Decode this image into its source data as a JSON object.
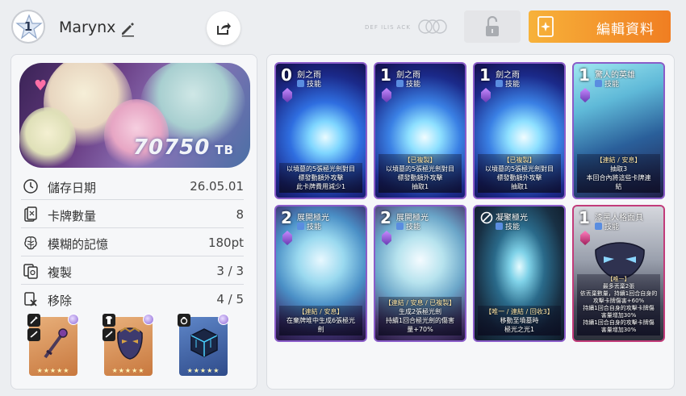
{
  "header": {
    "level": "1",
    "player_name": "Marynx",
    "watermark": "DEF ILIS ACK",
    "edit_profile_label": "編輯資料"
  },
  "profile": {
    "tb_value": "70750",
    "tb_unit": "TB",
    "stats": [
      {
        "icon": "clock-icon",
        "label": "儲存日期",
        "value": "26.05.01"
      },
      {
        "icon": "cards-icon",
        "label": "卡牌數量",
        "value": "8"
      },
      {
        "icon": "brain-icon",
        "label": "模糊的記憶",
        "value": "180pt"
      },
      {
        "icon": "copy-icon",
        "label": "複製",
        "value": "3 / 3"
      },
      {
        "icon": "remove-icon",
        "label": "移除",
        "value": "4 / 5"
      }
    ],
    "items": [
      {
        "name": "weapon-item",
        "stars": "★★★★★"
      },
      {
        "name": "armor-item",
        "stars": "★★★★★"
      },
      {
        "name": "accessory-item",
        "stars": "★★★★★"
      }
    ]
  },
  "cards": [
    {
      "cost": "0",
      "name": "劍之雨",
      "type": "技能",
      "desc": [
        "以墳墓的5張極光劍對目",
        "標發動額外攻擊",
        "此卡牌費用減少1"
      ],
      "tag": ""
    },
    {
      "cost": "1",
      "name": "劍之雨",
      "type": "技能",
      "desc": [
        "以墳墓的5張極光劍對目",
        "標發動額外攻擊",
        "抽取1"
      ],
      "tag": "【已複製】"
    },
    {
      "cost": "1",
      "name": "劍之雨",
      "type": "技能",
      "desc": [
        "以墳墓的5張極光劍對目",
        "標發動額外攻擊",
        "抽取1"
      ],
      "tag": "【已複製】"
    },
    {
      "cost": "1",
      "name": "驚人的英雄",
      "type": "技能",
      "desc": [
        "抽取3",
        "本回合內將這些卡牌連",
        "結"
      ],
      "tag": "【連結 / 安息】"
    },
    {
      "cost": "2",
      "name": "展開極光",
      "type": "技能",
      "desc": [
        "在棄牌堆中生成6張極光",
        "劍"
      ],
      "tag": "【連結 / 安息】"
    },
    {
      "cost": "2",
      "name": "展開極光",
      "type": "技能",
      "desc": [
        "生成2張極光劍",
        "持續1回合極光劍的傷害",
        "量+70%"
      ],
      "tag": "【連結 / 安息 / 已複製】"
    },
    {
      "cost": "",
      "name": "凝聚極光",
      "type": "技能",
      "desc": [
        "移動至墳墓時",
        "極光之光1"
      ],
      "tag": "【唯一 / 連結 / 回收3】"
    },
    {
      "cost": "1",
      "name": "漆黑人格面具",
      "type": "技能",
      "desc": [
        "最多丟棄2張",
        "依丟棄數量，持續1回合自身的",
        "攻擊卡牌傷害+60%",
        "持續1回合自身的攻擊卡牌傷",
        "害量增加30%",
        "持續1回合自身的攻擊卡牌傷",
        "害量增加30%"
      ],
      "tag": "【唯一】"
    }
  ]
}
